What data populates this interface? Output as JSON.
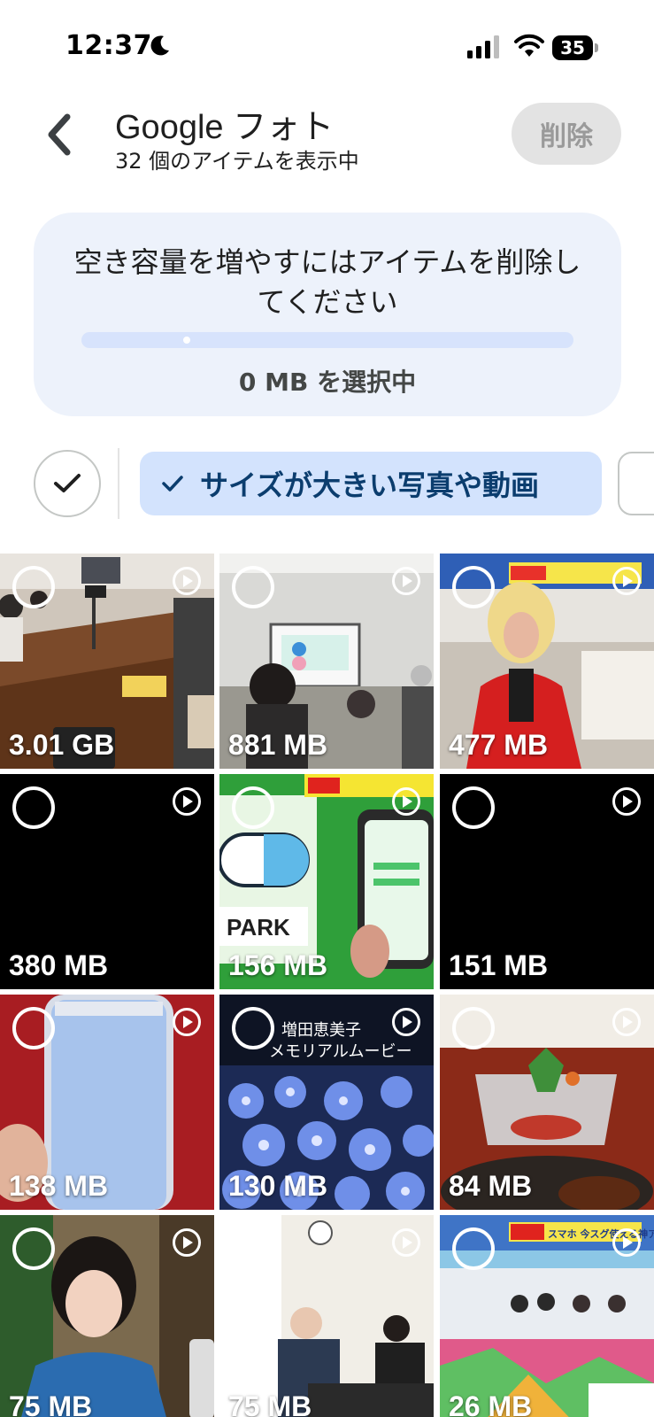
{
  "status_bar": {
    "time": "12:37",
    "battery": "35"
  },
  "header": {
    "title": "Google フォト",
    "subtitle": "32 個のアイテムを表示中",
    "delete_label": "削除"
  },
  "info_card": {
    "message": "空き容量を増やすにはアイテムを削除してください",
    "selected_text": "0 MB を選択中",
    "progress_fraction": 0.0
  },
  "filters": {
    "active_chip_label": "サイズが大きい写真や動画"
  },
  "grid": {
    "items": [
      {
        "size": "3.01 GB",
        "type": "video"
      },
      {
        "size": "881 MB",
        "type": "video"
      },
      {
        "size": "477 MB",
        "type": "video"
      },
      {
        "size": "380 MB",
        "type": "video"
      },
      {
        "size": "156 MB",
        "type": "video"
      },
      {
        "size": "151 MB",
        "type": "video"
      },
      {
        "size": "138 MB",
        "type": "video"
      },
      {
        "size": "130 MB",
        "type": "video"
      },
      {
        "size": "84 MB",
        "type": "video"
      },
      {
        "size": "75 MB",
        "type": "video"
      },
      {
        "size": "75 MB",
        "type": "video"
      },
      {
        "size": "26 MB",
        "type": "video"
      }
    ],
    "thumbnail_text": {
      "pill_text": "PARK",
      "memorial_line1": "増田恵美子",
      "memorial_line2": "メモリアルムービー",
      "tv_banner": "スマホ 今スグ使える神アプリ"
    }
  },
  "colors": {
    "accent_chip_bg": "#d3e3fd",
    "accent_chip_text": "#0b3d6e",
    "card_bg": "#edf2fb",
    "progress_track": "#d7e3fc",
    "delete_disabled_bg": "#e3e3e3"
  },
  "icons": {
    "back": "chevron-left-icon",
    "check": "check-icon",
    "play": "play-circle-icon",
    "select": "select-circle-icon"
  }
}
